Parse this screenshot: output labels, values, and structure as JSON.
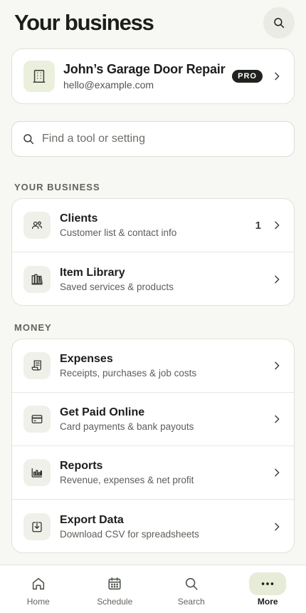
{
  "header": {
    "title": "Your business",
    "search_icon": "search-icon"
  },
  "profile": {
    "name": "John’s Garage Door Repair",
    "email": "hello@example.com",
    "badge": "PRO",
    "icon": "building-icon"
  },
  "search": {
    "placeholder": "Find a tool or setting",
    "value": ""
  },
  "sections": {
    "business": {
      "label": "YOUR BUSINESS",
      "items": [
        {
          "title": "Clients",
          "subtitle": "Customer list & contact info",
          "count": "1",
          "icon": "users-icon"
        },
        {
          "title": "Item Library",
          "subtitle": "Saved services & products",
          "icon": "library-icon"
        }
      ]
    },
    "money": {
      "label": "MONEY",
      "items": [
        {
          "title": "Expenses",
          "subtitle": "Receipts, purchases & job costs",
          "icon": "receipt-icon"
        },
        {
          "title": "Get Paid Online",
          "subtitle": "Card payments & bank payouts",
          "icon": "credit-card-icon"
        },
        {
          "title": "Reports",
          "subtitle": "Revenue, expenses & net profit",
          "icon": "bar-chart-icon"
        },
        {
          "title": "Export Data",
          "subtitle": "Download CSV for spreadsheets",
          "icon": "download-icon"
        }
      ]
    }
  },
  "tabbar": {
    "items": [
      {
        "label": "Home",
        "icon": "home-icon"
      },
      {
        "label": "Schedule",
        "icon": "calendar-icon"
      },
      {
        "label": "Search",
        "icon": "search-icon"
      },
      {
        "label": "More",
        "icon": "more-icon",
        "active": true
      }
    ]
  },
  "colors": {
    "background": "#f7f7f3",
    "card": "#ffffff",
    "accent_soft": "#e6ecd8",
    "text_primary": "#1b1e1a",
    "badge_bg": "#1f221d"
  }
}
